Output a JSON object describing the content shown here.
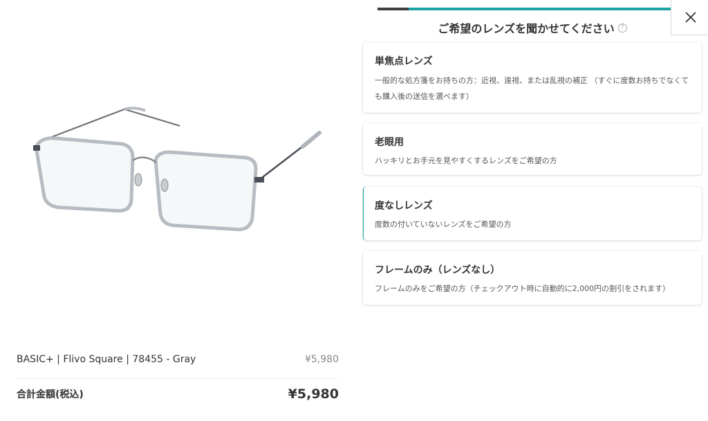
{
  "product": {
    "name": "BASIC+ | Flivo Square | 78455 - Gray",
    "price": "¥5,980"
  },
  "summary": {
    "total_label": "合計金額(税込)",
    "total_value": "¥5,980"
  },
  "wizard": {
    "progress_fraction": 0.105,
    "heading": "ご希望のレンズを聞かせてください",
    "help_icon": "question-circle-icon",
    "close_icon": "close-x-icon",
    "accent_color": "#1aa4a4",
    "options": [
      {
        "title": "単焦点レンズ",
        "description": "一般的な処方箋をお持ちの方：近視、遠視、または乱視の補正 （すぐに度数お持ちでなくても購入後の送信を選べます）"
      },
      {
        "title": "老眼用",
        "description": "ハッキリとお手元を見やすくするレンズをご希望の方"
      },
      {
        "title": "度なしレンズ",
        "description": "度数の付いていないレンズをご希望の方"
      },
      {
        "title": "フレームのみ（レンズなし）",
        "description": "フレームのみをご希望の方（チェックアウト時に自動的に2,000円の割引をされます）"
      }
    ]
  }
}
